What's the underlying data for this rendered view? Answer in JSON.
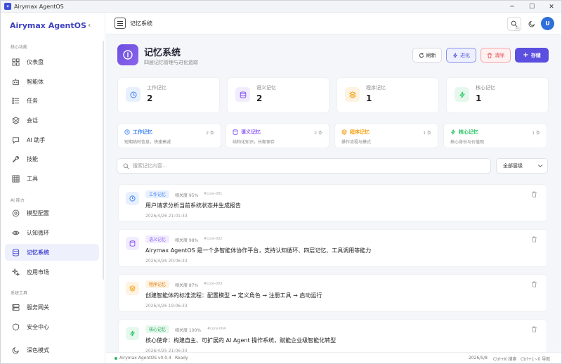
{
  "window": {
    "title": "Airymax AgentOS"
  },
  "sidebar": {
    "brand": "Airymax AgentOS",
    "sections": [
      "核心功能",
      "AI 能力",
      "系统工具"
    ],
    "items": [
      {
        "label": "仪表盘",
        "icon": "dashboard-icon"
      },
      {
        "label": "智能体",
        "icon": "bot-icon"
      },
      {
        "label": "任务",
        "icon": "list-icon"
      },
      {
        "label": "会话",
        "icon": "layers-icon"
      },
      {
        "label": "AI 助手",
        "icon": "chat-icon"
      },
      {
        "label": "技能",
        "icon": "wrench-icon"
      },
      {
        "label": "工具",
        "icon": "grid-icon"
      },
      {
        "label": "模型配置",
        "icon": "target-icon"
      },
      {
        "label": "认知循环",
        "icon": "eye-icon"
      },
      {
        "label": "记忆系统",
        "icon": "database-icon",
        "active": true
      },
      {
        "label": "应用市场",
        "icon": "sparkle-icon"
      },
      {
        "label": "服务网关",
        "icon": "server-icon"
      },
      {
        "label": "安全中心",
        "icon": "shield-icon"
      }
    ],
    "dark_mode": "深色模式"
  },
  "header": {
    "breadcrumb": "记忆系统",
    "search_hint": "⌘K",
    "avatar": "U"
  },
  "page": {
    "title": "记忆系统",
    "subtitle": "四层记忆管理与进化追踪",
    "actions": {
      "refresh": "刷新",
      "evolve": "进化",
      "clear": "清除",
      "store": "存储"
    }
  },
  "stats": [
    {
      "label": "工作记忆",
      "value": "2",
      "color": "#3b82f6",
      "bg": "#e8f0fe"
    },
    {
      "label": "语义记忆",
      "value": "2",
      "color": "#8b5cf6",
      "bg": "#f1ecfe"
    },
    {
      "label": "程序记忆",
      "value": "1",
      "color": "#f59e0b",
      "bg": "#fef3e2"
    },
    {
      "label": "核心记忆",
      "value": "1",
      "color": "#22c55e",
      "bg": "#e6f8ee"
    }
  ],
  "layers": [
    {
      "name": "工作记忆",
      "count": "2 条",
      "desc": "短期临时信息，快速衰减",
      "color": "#3b82f6"
    },
    {
      "name": "语义记忆",
      "count": "2 条",
      "desc": "结构化知识，长期保存",
      "color": "#8b5cf6"
    },
    {
      "name": "程序记忆",
      "count": "1 条",
      "desc": "操作流程与模式",
      "color": "#f59e0b"
    },
    {
      "name": "核心记忆",
      "count": "1 条",
      "desc": "核心身份与价值观",
      "color": "#22c55e"
    }
  ],
  "search": {
    "placeholder": "搜索记忆内容...",
    "filter": "全部层级"
  },
  "memories": [
    {
      "tag": "工作记忆",
      "relevance": "相关度 95%",
      "id": "#core-001",
      "text": "用户请求分析当前系统状态并生成报告",
      "time": "2026/4/26 21:01:33",
      "color": "#3b82f6",
      "bg": "#e8f0fe"
    },
    {
      "tag": "语义记忆",
      "relevance": "相关度 98%",
      "id": "#core-002",
      "text": "Airymax AgentOS 是一个多智能体协作平台，支持认知循环、四层记忆、工具调用等能力",
      "time": "2026/4/26 20:06:33",
      "color": "#8b5cf6",
      "bg": "#f1ecfe"
    },
    {
      "tag": "程序记忆",
      "relevance": "相关度 87%",
      "id": "#core-003",
      "text": "创建智能体的标准流程：配置模型 → 定义角色 → 注册工具 → 启动运行",
      "time": "2026/4/26 19:06:33",
      "color": "#f59e0b",
      "bg": "#fef3e2"
    },
    {
      "tag": "核心记忆",
      "relevance": "相关度 100%",
      "id": "#core-004",
      "text": "核心使命：构建自主、可扩展的 AI Agent 操作系统，赋能企业级智能化转型",
      "time": "2026/4/25 21:06:33",
      "color": "#22c55e",
      "bg": "#e6f8ee"
    }
  ],
  "status": {
    "version": "Airymax AgentOS v0.0.4",
    "state": "Ready",
    "date": "2026/5/8",
    "search_shortcut": "Ctrl+K 搜索",
    "nav_shortcut": "Ctrl+1~0 导航"
  }
}
